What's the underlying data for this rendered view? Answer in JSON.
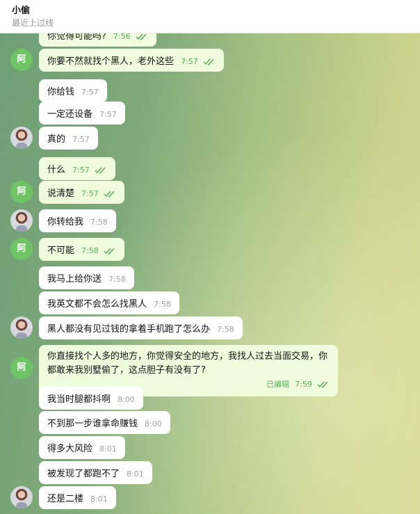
{
  "header": {
    "name": "小偷",
    "status": "最近上过线"
  },
  "avatars": {
    "self_initial": "阿"
  },
  "messages": [
    {
      "text": "你觉得可能吗?",
      "time": "7:56"
    },
    {
      "text": "你要不然就找个黑人，老外这些",
      "time": "7:57"
    },
    {
      "text": "你给钱",
      "time": "7:57"
    },
    {
      "text": "一定还设备",
      "time": "7:57"
    },
    {
      "text": "真的",
      "time": "7:57"
    },
    {
      "text": "什么",
      "time": "7:57"
    },
    {
      "text": "说清楚",
      "time": "7:57"
    },
    {
      "text": "你转给我",
      "time": "7:58"
    },
    {
      "text": "不可能",
      "time": "7:58"
    },
    {
      "text": "我马上给你送",
      "time": "7:58"
    },
    {
      "text": "我英文都不会怎么找黑人",
      "time": "7:58"
    },
    {
      "text": "黑人都没有见过钱的拿着手机跑了怎么办",
      "time": "7:58"
    },
    {
      "text": "你直接找个人多的地方，你觉得安全的地方，我找人过去当面交易，你都敢来我别墅偷了，这点胆子有没有了?",
      "time": "7:59",
      "edited": "已编辑"
    },
    {
      "text": "我当时腿都抖啊",
      "time": "8:00"
    },
    {
      "text": "不到那一步谁拿命赚钱",
      "time": "8:00"
    },
    {
      "text": "得多大风险",
      "time": "8:01"
    },
    {
      "text": "被发现了都跑不了",
      "time": "8:01"
    },
    {
      "text": "还是二楼",
      "time": "8:01"
    }
  ]
}
